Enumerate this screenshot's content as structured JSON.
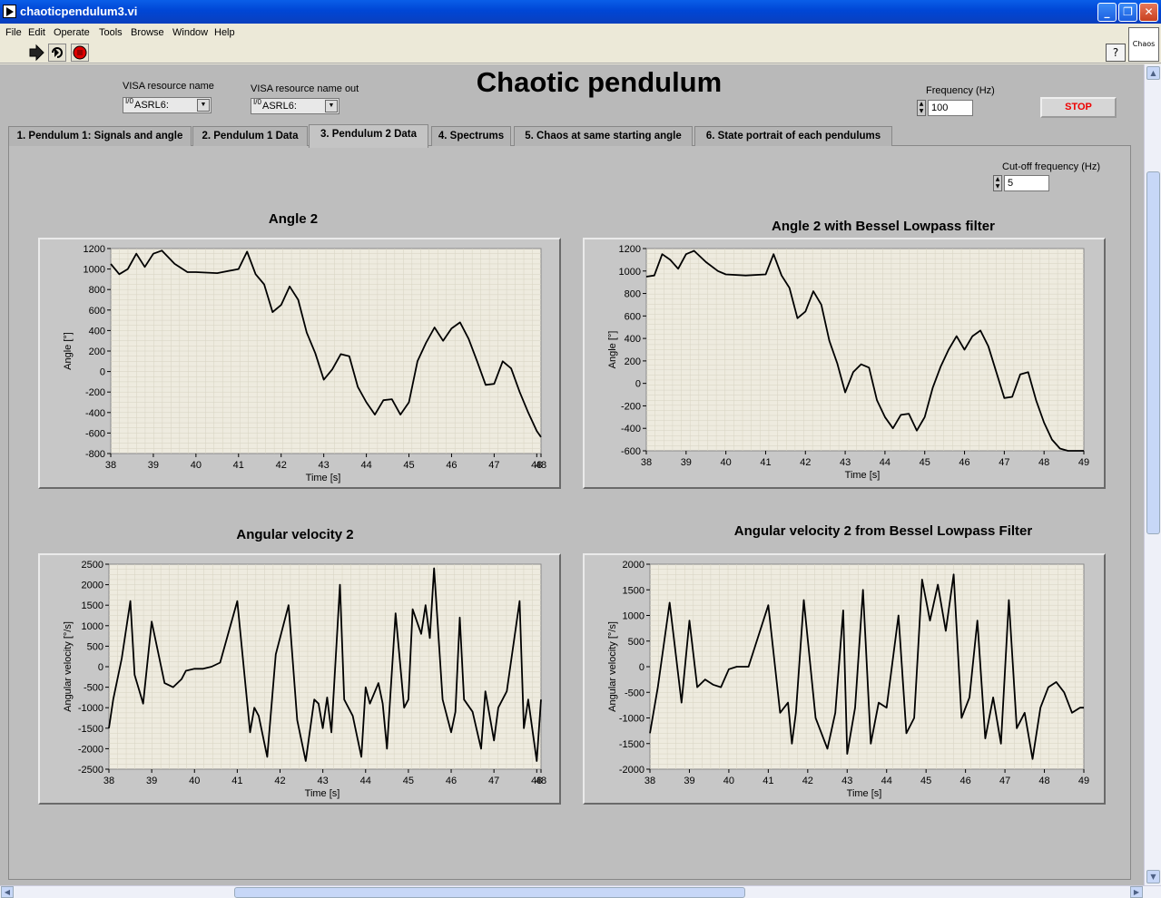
{
  "window": {
    "title": "chaoticpendulum3.vi"
  },
  "menu": [
    "File",
    "Edit",
    "Operate",
    "Tools",
    "Browse",
    "Window",
    "Help"
  ],
  "toolbar": {
    "chaos_label": "Chaos",
    "help": "?"
  },
  "controls": {
    "visa_in_label": "VISA resource name",
    "visa_in_value": "ASRL6:",
    "visa_out_label": "VISA resource name out",
    "visa_out_value": "ASRL6:",
    "io_glyph": "I/0",
    "frequency_label": "Frequency (Hz)",
    "frequency_value": "100",
    "stop_label": "STOP",
    "cutoff_label": "Cut-off frequency (Hz)",
    "cutoff_value": "5"
  },
  "page_title": "Chaotic pendulum",
  "tabs": [
    "1. Pendulum 1: Signals and angle",
    "2. Pendulum 1 Data",
    "3. Pendulum 2 Data",
    "4. Spectrums",
    "5. Chaos at same starting angle",
    "6. State portrait of each pendulums"
  ],
  "active_tab": 2,
  "colors": {
    "plot_bg": "#eeebdf",
    "grid": "#d7d3c2",
    "trace": "#000000",
    "frame": "#c7c7c7"
  },
  "chart_data": [
    {
      "type": "line",
      "title": "Angle 2",
      "xlabel": "Time [s]",
      "ylabel": "Angle [°]",
      "xlim": [
        38,
        48.1
      ],
      "ylim": [
        -800,
        1200
      ],
      "xticks": [
        "38",
        "39",
        "40",
        "41",
        "42",
        "43",
        "44",
        "45",
        "46",
        "47",
        "48",
        "48"
      ],
      "xtick_values": [
        38,
        39,
        40,
        41,
        42,
        43,
        44,
        45,
        46,
        47,
        48,
        48.1
      ],
      "yticks": [
        1200,
        1000,
        800,
        600,
        400,
        200,
        0,
        -200,
        -400,
        -600,
        -800
      ],
      "series": [
        {
          "x": [
            38,
            38.2,
            38.4,
            38.6,
            38.8,
            39,
            39.2,
            39.5,
            39.8,
            40,
            40.5,
            41,
            41.2,
            41.4,
            41.6,
            41.8,
            42,
            42.2,
            42.4,
            42.6,
            42.8,
            43,
            43.2,
            43.4,
            43.6,
            43.8,
            44,
            44.2,
            44.4,
            44.6,
            44.8,
            45,
            45.2,
            45.4,
            45.6,
            45.8,
            46,
            46.2,
            46.4,
            46.6,
            46.8,
            47,
            47.2,
            47.4,
            47.6,
            47.8,
            48,
            48.1
          ],
          "y": [
            1050,
            950,
            1000,
            1150,
            1020,
            1150,
            1180,
            1050,
            970,
            970,
            960,
            1000,
            1170,
            950,
            850,
            580,
            650,
            830,
            700,
            380,
            180,
            -80,
            20,
            170,
            150,
            -150,
            -300,
            -420,
            -280,
            -270,
            -420,
            -300,
            100,
            280,
            430,
            300,
            420,
            480,
            320,
            100,
            -130,
            -120,
            100,
            30,
            -200,
            -400,
            -580,
            -640
          ]
        }
      ]
    },
    {
      "type": "line",
      "title": "Angle 2 with Bessel Lowpass filter",
      "xlabel": "Time [s]",
      "ylabel": "Angle [°]",
      "xlim": [
        38,
        49
      ],
      "ylim": [
        -600,
        1200
      ],
      "xticks": [
        "38",
        "39",
        "40",
        "41",
        "42",
        "43",
        "44",
        "45",
        "46",
        "47",
        "48",
        "49"
      ],
      "xtick_values": [
        38,
        39,
        40,
        41,
        42,
        43,
        44,
        45,
        46,
        47,
        48,
        49
      ],
      "yticks": [
        1200,
        1000,
        800,
        600,
        400,
        200,
        0,
        -200,
        -400,
        -600
      ],
      "series": [
        {
          "x": [
            38,
            38.2,
            38.4,
            38.6,
            38.8,
            39,
            39.2,
            39.5,
            39.8,
            40,
            40.5,
            41,
            41.2,
            41.4,
            41.6,
            41.8,
            42,
            42.2,
            42.4,
            42.6,
            42.8,
            43,
            43.2,
            43.4,
            43.6,
            43.8,
            44,
            44.2,
            44.4,
            44.6,
            44.8,
            45,
            45.2,
            45.4,
            45.6,
            45.8,
            46,
            46.2,
            46.4,
            46.6,
            46.8,
            47,
            47.2,
            47.4,
            47.6,
            47.8,
            48,
            48.2,
            48.4,
            48.6,
            48.8,
            49
          ],
          "y": [
            950,
            960,
            1150,
            1100,
            1020,
            1150,
            1180,
            1080,
            1000,
            970,
            960,
            970,
            1150,
            960,
            850,
            580,
            640,
            820,
            700,
            380,
            180,
            -80,
            100,
            170,
            140,
            -150,
            -300,
            -400,
            -280,
            -270,
            -420,
            -300,
            -40,
            150,
            300,
            420,
            300,
            420,
            470,
            330,
            100,
            -130,
            -120,
            80,
            100,
            -150,
            -350,
            -500,
            -580,
            -600,
            -600,
            -600
          ]
        }
      ]
    },
    {
      "type": "line",
      "title": "Angular velocity 2",
      "xlabel": "Time [s]",
      "ylabel": "Angular velocity [°/s]",
      "xlim": [
        38,
        48.1
      ],
      "ylim": [
        -2500,
        2500
      ],
      "xticks": [
        "38",
        "39",
        "40",
        "41",
        "42",
        "43",
        "44",
        "45",
        "46",
        "47",
        "48",
        "48"
      ],
      "xtick_values": [
        38,
        39,
        40,
        41,
        42,
        43,
        44,
        45,
        46,
        47,
        48,
        48.1
      ],
      "yticks": [
        2500,
        2000,
        1500,
        1000,
        500,
        0,
        -500,
        -1000,
        -1500,
        -2000,
        -2500
      ],
      "series": [
        {
          "x": [
            38,
            38.1,
            38.3,
            38.5,
            38.6,
            38.8,
            39,
            39.3,
            39.5,
            39.7,
            39.8,
            40,
            40.2,
            40.4,
            40.6,
            41,
            41.3,
            41.4,
            41.5,
            41.7,
            41.9,
            42.2,
            42.4,
            42.6,
            42.8,
            42.9,
            43,
            43.1,
            43.2,
            43.4,
            43.5,
            43.7,
            43.9,
            44,
            44.1,
            44.3,
            44.4,
            44.5,
            44.7,
            44.9,
            45,
            45.1,
            45.3,
            45.4,
            45.5,
            45.6,
            45.7,
            45.8,
            46,
            46.1,
            46.2,
            46.3,
            46.5,
            46.7,
            46.8,
            47,
            47.1,
            47.3,
            47.6,
            47.7,
            47.8,
            48,
            48.1
          ],
          "y": [
            -1500,
            -800,
            200,
            1600,
            -200,
            -900,
            1100,
            -400,
            -500,
            -300,
            -100,
            -50,
            -50,
            0,
            100,
            1600,
            -1600,
            -1000,
            -1200,
            -2200,
            300,
            1500,
            -1300,
            -2300,
            -800,
            -900,
            -1500,
            -750,
            -1600,
            2000,
            -800,
            -1200,
            -2200,
            -500,
            -900,
            -400,
            -900,
            -2000,
            1300,
            -1000,
            -800,
            1400,
            800,
            1500,
            700,
            2400,
            800,
            -800,
            -1600,
            -1100,
            1200,
            -800,
            -1100,
            -2000,
            -600,
            -1800,
            -1000,
            -600,
            1600,
            -1500,
            -800,
            -2300,
            -800
          ]
        }
      ]
    },
    {
      "type": "line",
      "title": "Angular velocity 2 from Bessel Lowpass Filter",
      "xlabel": "Time [s]",
      "ylabel": "Angular velocity [°/s]",
      "xlim": [
        38,
        49
      ],
      "ylim": [
        -2000,
        2000
      ],
      "xticks": [
        "38",
        "39",
        "40",
        "41",
        "42",
        "43",
        "44",
        "45",
        "46",
        "47",
        "48",
        "49"
      ],
      "xtick_values": [
        38,
        39,
        40,
        41,
        42,
        43,
        44,
        45,
        46,
        47,
        48,
        49
      ],
      "yticks": [
        2000,
        1500,
        1000,
        500,
        0,
        -500,
        -1000,
        -1500,
        -2000
      ],
      "series": [
        {
          "x": [
            38,
            38.2,
            38.5,
            38.8,
            39,
            39.2,
            39.4,
            39.6,
            39.8,
            40,
            40.2,
            40.5,
            41,
            41.3,
            41.5,
            41.6,
            41.7,
            41.9,
            42.2,
            42.5,
            42.7,
            42.9,
            43,
            43.2,
            43.4,
            43.6,
            43.8,
            44,
            44.3,
            44.5,
            44.7,
            44.9,
            45.1,
            45.3,
            45.5,
            45.7,
            45.9,
            46.1,
            46.3,
            46.5,
            46.7,
            46.9,
            47.1,
            47.3,
            47.5,
            47.7,
            47.9,
            48.1,
            48.3,
            48.5,
            48.7,
            48.9,
            49
          ],
          "y": [
            -1300,
            -400,
            1250,
            -700,
            900,
            -400,
            -250,
            -350,
            -400,
            -50,
            0,
            0,
            1200,
            -900,
            -700,
            -1500,
            -900,
            1300,
            -1000,
            -1600,
            -900,
            1100,
            -1700,
            -800,
            1500,
            -1500,
            -700,
            -800,
            1000,
            -1300,
            -1000,
            1700,
            900,
            1600,
            700,
            1800,
            -1000,
            -600,
            900,
            -1400,
            -600,
            -1500,
            1300,
            -1200,
            -900,
            -1800,
            -800,
            -400,
            -300,
            -500,
            -900,
            -800,
            -800
          ]
        }
      ]
    }
  ]
}
